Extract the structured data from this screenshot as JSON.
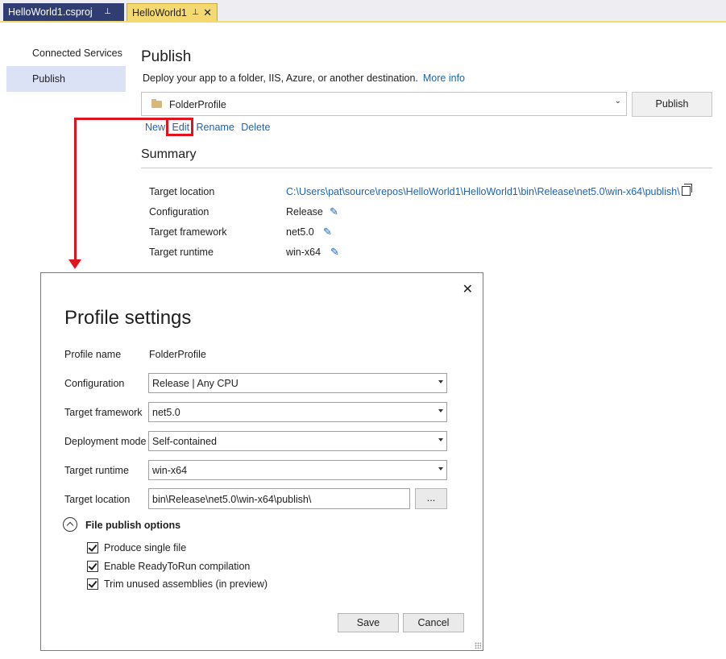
{
  "tabs": [
    {
      "label": "HelloWorld1.csproj",
      "pin": "⊥"
    },
    {
      "label": "HelloWorld1",
      "pin": "⊥",
      "close": "✕"
    }
  ],
  "sidebar": {
    "items": [
      {
        "label": "Connected Services"
      },
      {
        "label": "Publish"
      }
    ]
  },
  "main": {
    "title": "Publish",
    "description": "Deploy your app to a folder, IIS, Azure, or another destination.",
    "more_info": "More info",
    "profile": "FolderProfile",
    "publish_button": "Publish",
    "actions": {
      "new": "New",
      "edit": "Edit",
      "rename": "Rename",
      "delete": "Delete"
    },
    "summary": {
      "title": "Summary",
      "rows": [
        {
          "label": "Target location",
          "value": "C:\\Users\\pat\\source\\repos\\HelloWorld1\\HelloWorld1\\bin\\Release\\net5.0\\win-x64\\publish\\"
        },
        {
          "label": "Configuration",
          "value": "Release"
        },
        {
          "label": "Target framework",
          "value": "net5.0"
        },
        {
          "label": "Target runtime",
          "value": "win-x64"
        }
      ]
    }
  },
  "dialog": {
    "title": "Profile settings",
    "close": "✕",
    "profile_name_label": "Profile name",
    "profile_name_value": "FolderProfile",
    "fields": [
      {
        "label": "Configuration",
        "value": "Release | Any CPU"
      },
      {
        "label": "Target framework",
        "value": "net5.0"
      },
      {
        "label": "Deployment mode",
        "value": "Self-contained"
      },
      {
        "label": "Target runtime",
        "value": "win-x64"
      }
    ],
    "target_location_label": "Target location",
    "target_location_value": "bin\\Release\\net5.0\\win-x64\\publish\\",
    "browse": "...",
    "file_publish_options": "File publish options",
    "checkboxes": [
      {
        "label": "Produce single file",
        "checked": true
      },
      {
        "label": "Enable ReadyToRun compilation",
        "checked": true
      },
      {
        "label": "Trim unused assemblies (in preview)",
        "checked": true
      }
    ],
    "save": "Save",
    "cancel": "Cancel"
  },
  "colors": {
    "link": "#1a63b6",
    "highlight": "#e0141e",
    "active_tab": "#f4d971",
    "inactive_tab": "#2f3d73"
  }
}
